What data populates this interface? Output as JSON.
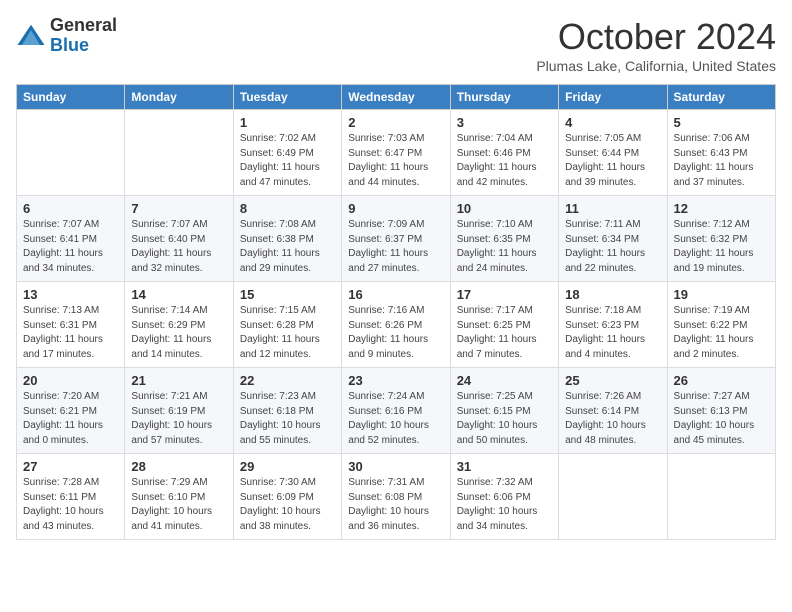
{
  "header": {
    "logo_line1": "General",
    "logo_line2": "Blue",
    "month_title": "October 2024",
    "location": "Plumas Lake, California, United States"
  },
  "weekdays": [
    "Sunday",
    "Monday",
    "Tuesday",
    "Wednesday",
    "Thursday",
    "Friday",
    "Saturday"
  ],
  "weeks": [
    [
      {
        "day": "",
        "info": ""
      },
      {
        "day": "",
        "info": ""
      },
      {
        "day": "1",
        "info": "Sunrise: 7:02 AM\nSunset: 6:49 PM\nDaylight: 11 hours and 47 minutes."
      },
      {
        "day": "2",
        "info": "Sunrise: 7:03 AM\nSunset: 6:47 PM\nDaylight: 11 hours and 44 minutes."
      },
      {
        "day": "3",
        "info": "Sunrise: 7:04 AM\nSunset: 6:46 PM\nDaylight: 11 hours and 42 minutes."
      },
      {
        "day": "4",
        "info": "Sunrise: 7:05 AM\nSunset: 6:44 PM\nDaylight: 11 hours and 39 minutes."
      },
      {
        "day": "5",
        "info": "Sunrise: 7:06 AM\nSunset: 6:43 PM\nDaylight: 11 hours and 37 minutes."
      }
    ],
    [
      {
        "day": "6",
        "info": "Sunrise: 7:07 AM\nSunset: 6:41 PM\nDaylight: 11 hours and 34 minutes."
      },
      {
        "day": "7",
        "info": "Sunrise: 7:07 AM\nSunset: 6:40 PM\nDaylight: 11 hours and 32 minutes."
      },
      {
        "day": "8",
        "info": "Sunrise: 7:08 AM\nSunset: 6:38 PM\nDaylight: 11 hours and 29 minutes."
      },
      {
        "day": "9",
        "info": "Sunrise: 7:09 AM\nSunset: 6:37 PM\nDaylight: 11 hours and 27 minutes."
      },
      {
        "day": "10",
        "info": "Sunrise: 7:10 AM\nSunset: 6:35 PM\nDaylight: 11 hours and 24 minutes."
      },
      {
        "day": "11",
        "info": "Sunrise: 7:11 AM\nSunset: 6:34 PM\nDaylight: 11 hours and 22 minutes."
      },
      {
        "day": "12",
        "info": "Sunrise: 7:12 AM\nSunset: 6:32 PM\nDaylight: 11 hours and 19 minutes."
      }
    ],
    [
      {
        "day": "13",
        "info": "Sunrise: 7:13 AM\nSunset: 6:31 PM\nDaylight: 11 hours and 17 minutes."
      },
      {
        "day": "14",
        "info": "Sunrise: 7:14 AM\nSunset: 6:29 PM\nDaylight: 11 hours and 14 minutes."
      },
      {
        "day": "15",
        "info": "Sunrise: 7:15 AM\nSunset: 6:28 PM\nDaylight: 11 hours and 12 minutes."
      },
      {
        "day": "16",
        "info": "Sunrise: 7:16 AM\nSunset: 6:26 PM\nDaylight: 11 hours and 9 minutes."
      },
      {
        "day": "17",
        "info": "Sunrise: 7:17 AM\nSunset: 6:25 PM\nDaylight: 11 hours and 7 minutes."
      },
      {
        "day": "18",
        "info": "Sunrise: 7:18 AM\nSunset: 6:23 PM\nDaylight: 11 hours and 4 minutes."
      },
      {
        "day": "19",
        "info": "Sunrise: 7:19 AM\nSunset: 6:22 PM\nDaylight: 11 hours and 2 minutes."
      }
    ],
    [
      {
        "day": "20",
        "info": "Sunrise: 7:20 AM\nSunset: 6:21 PM\nDaylight: 11 hours and 0 minutes."
      },
      {
        "day": "21",
        "info": "Sunrise: 7:21 AM\nSunset: 6:19 PM\nDaylight: 10 hours and 57 minutes."
      },
      {
        "day": "22",
        "info": "Sunrise: 7:23 AM\nSunset: 6:18 PM\nDaylight: 10 hours and 55 minutes."
      },
      {
        "day": "23",
        "info": "Sunrise: 7:24 AM\nSunset: 6:16 PM\nDaylight: 10 hours and 52 minutes."
      },
      {
        "day": "24",
        "info": "Sunrise: 7:25 AM\nSunset: 6:15 PM\nDaylight: 10 hours and 50 minutes."
      },
      {
        "day": "25",
        "info": "Sunrise: 7:26 AM\nSunset: 6:14 PM\nDaylight: 10 hours and 48 minutes."
      },
      {
        "day": "26",
        "info": "Sunrise: 7:27 AM\nSunset: 6:13 PM\nDaylight: 10 hours and 45 minutes."
      }
    ],
    [
      {
        "day": "27",
        "info": "Sunrise: 7:28 AM\nSunset: 6:11 PM\nDaylight: 10 hours and 43 minutes."
      },
      {
        "day": "28",
        "info": "Sunrise: 7:29 AM\nSunset: 6:10 PM\nDaylight: 10 hours and 41 minutes."
      },
      {
        "day": "29",
        "info": "Sunrise: 7:30 AM\nSunset: 6:09 PM\nDaylight: 10 hours and 38 minutes."
      },
      {
        "day": "30",
        "info": "Sunrise: 7:31 AM\nSunset: 6:08 PM\nDaylight: 10 hours and 36 minutes."
      },
      {
        "day": "31",
        "info": "Sunrise: 7:32 AM\nSunset: 6:06 PM\nDaylight: 10 hours and 34 minutes."
      },
      {
        "day": "",
        "info": ""
      },
      {
        "day": "",
        "info": ""
      }
    ]
  ]
}
